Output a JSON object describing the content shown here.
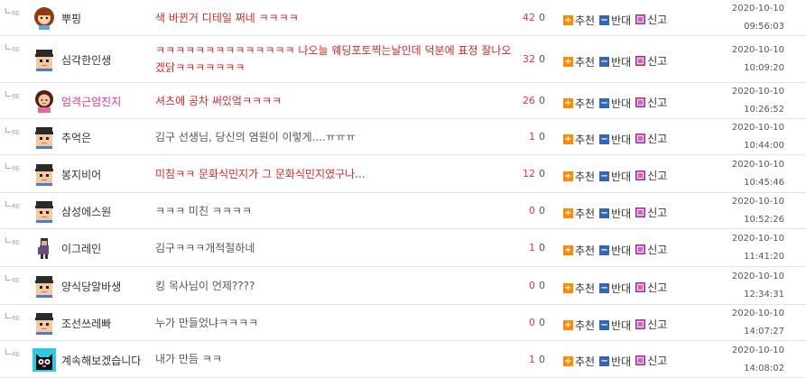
{
  "labels": {
    "re": "RE",
    "recommend": "추천",
    "oppose": "반대",
    "report": "신고"
  },
  "colors": {
    "hot_text": "#d12a2a",
    "normal_text": "#555555",
    "pink_nick": "#e0368f",
    "upvote": "#ee3333"
  },
  "comments": [
    {
      "nick": "뿌핑",
      "avatar": "girl-avatar",
      "nick_style": "normal",
      "content": "색 바뀐거 디테일 쩌네 ㅋㅋㅋㅋ",
      "hot": true,
      "up": "42",
      "down": "0",
      "date": "2020-10-10",
      "time": "09:56:03"
    },
    {
      "nick": "심각한인생",
      "avatar": "pixel-avatar",
      "nick_style": "normal",
      "content": "ㅋㅋㅋㅋㅋㅋㅋㅋㅋㅋㅋㅋㅋㅋ 나오늘 웨딩포토찍는날인데 덕분에 표정 잘나오겠닭ㅋㅋㅋㅋㅋㅋㅋ",
      "hot": true,
      "up": "32",
      "down": "0",
      "date": "2020-10-10",
      "time": "10:09:20"
    },
    {
      "nick": "엄격근엄진지",
      "avatar": "woman-avatar",
      "nick_style": "pink",
      "content": "셔츠에 공차 써있엌ㅋㅋㅋㅋ",
      "hot": true,
      "up": "26",
      "down": "0",
      "date": "2020-10-10",
      "time": "10:26:52"
    },
    {
      "nick": "추억은",
      "avatar": "pixel-avatar",
      "nick_style": "normal",
      "content": "김구 선생님, 당신의 염원이 이렇게....ㅠㅠㅠ",
      "hot": false,
      "up": "1",
      "down": "0",
      "date": "2020-10-10",
      "time": "10:44:00"
    },
    {
      "nick": "봉지비어",
      "avatar": "pixel-avatar",
      "nick_style": "normal",
      "content": "미침ㅋㅋ 문화식민지가 그 문화식민지였구나...",
      "hot": true,
      "up": "12",
      "down": "0",
      "date": "2020-10-10",
      "time": "10:45:46"
    },
    {
      "nick": "삼성에스원",
      "avatar": "pixel-avatar",
      "nick_style": "normal",
      "content": "ㅋㅋㅋ 미친 ㅋㅋㅋㅋ",
      "hot": false,
      "up": "0",
      "down": "0",
      "date": "2020-10-10",
      "time": "10:52:26"
    },
    {
      "nick": "이그레인",
      "avatar": "character-avatar",
      "nick_style": "normal",
      "content": "김구ㅋㅋㅋ개적절하네",
      "hot": false,
      "up": "1",
      "down": "0",
      "date": "2020-10-10",
      "time": "11:41:20"
    },
    {
      "nick": "양식당알바생",
      "avatar": "pixel-avatar",
      "nick_style": "normal",
      "content": "킹 목사님이 언제????",
      "hot": false,
      "up": "0",
      "down": "0",
      "date": "2020-10-10",
      "time": "12:34:31"
    },
    {
      "nick": "조선쓰레빠",
      "avatar": "pixel-avatar",
      "nick_style": "normal",
      "content": "누가 만들었냐ㅋㅋㅋㅋ",
      "hot": false,
      "up": "0",
      "down": "0",
      "date": "2020-10-10",
      "time": "14:07:27"
    },
    {
      "nick": "계속해보겠습니다",
      "avatar": "cat-avatar",
      "nick_style": "normal",
      "content": "내가 만듬 ㅋㅋ",
      "hot": false,
      "up": "1",
      "down": "0",
      "date": "2020-10-10",
      "time": "14:08:02"
    }
  ]
}
